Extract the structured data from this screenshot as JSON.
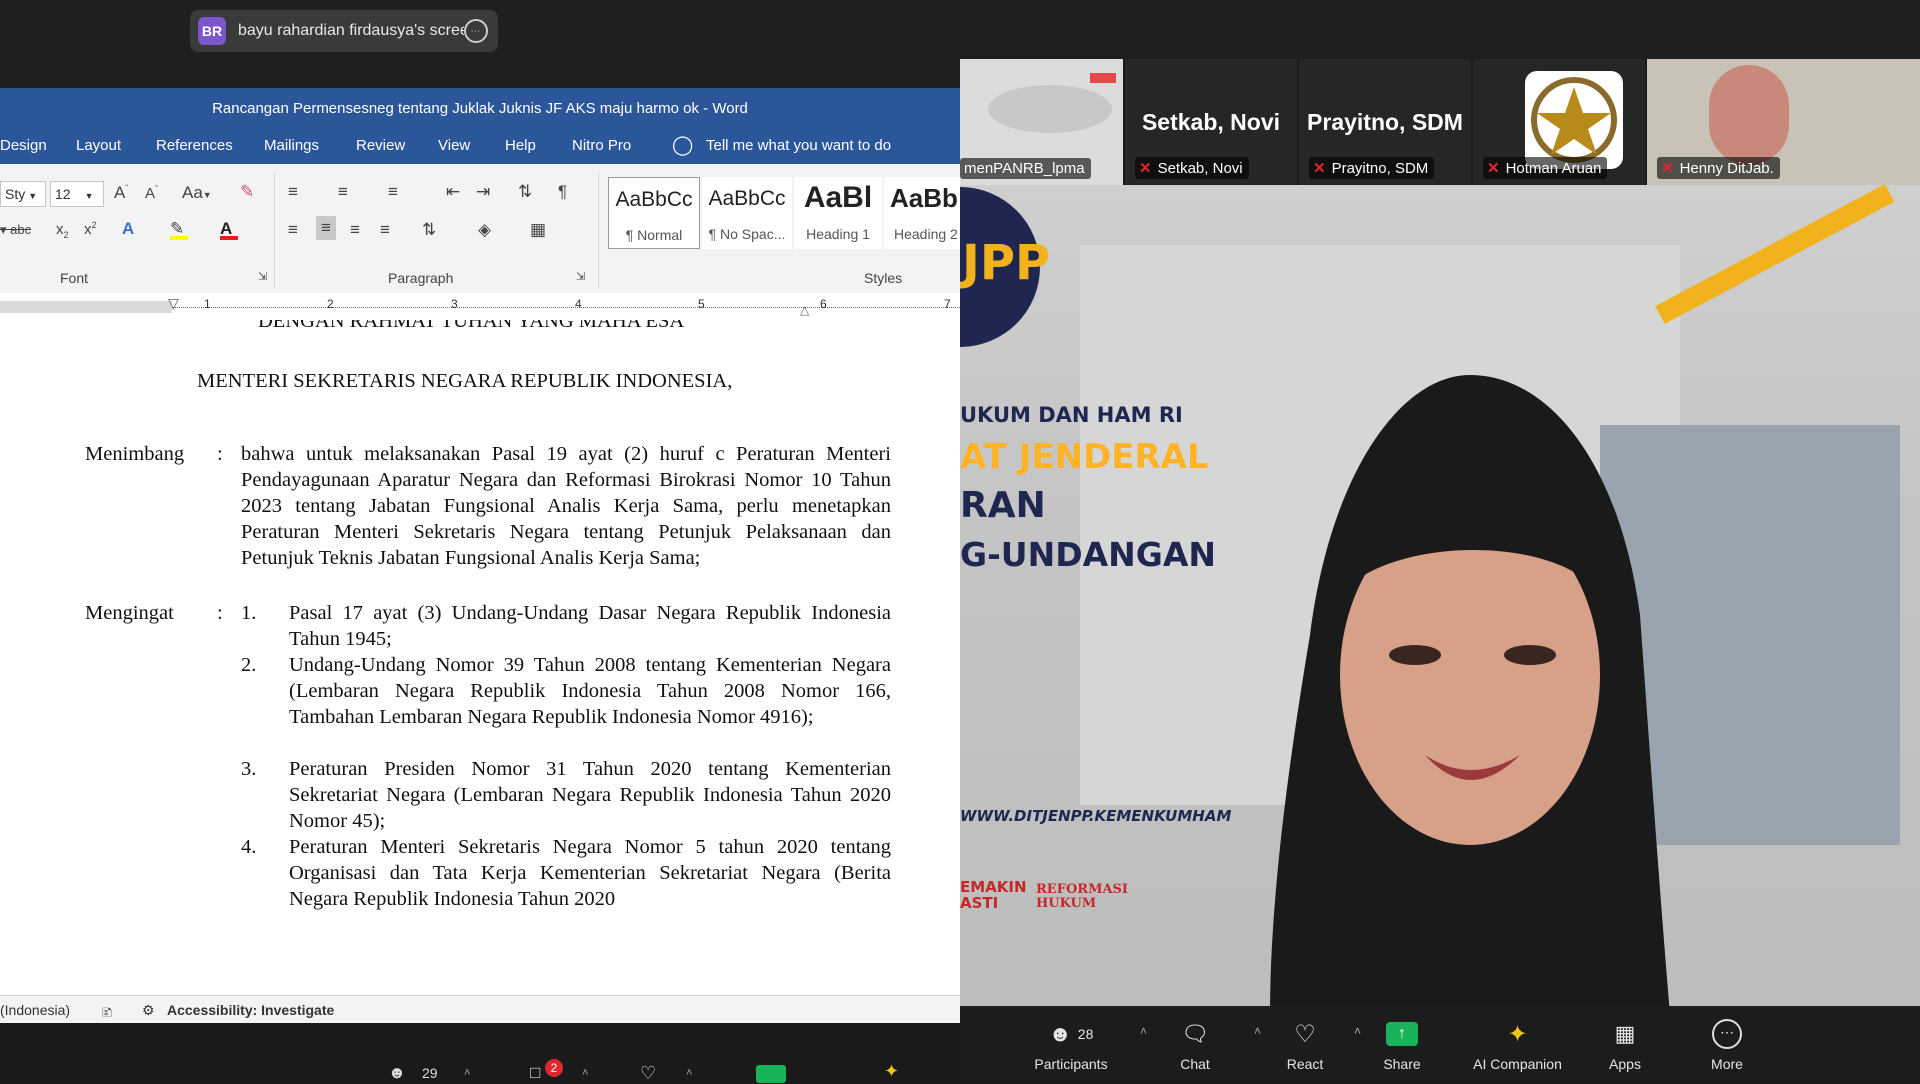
{
  "share_banner": {
    "avatar": "BR",
    "label": "bayu rahardian firdausya's screen",
    "more": "⋯"
  },
  "word": {
    "title": "Rancangan Permensesneg tentang Juklak Juknis JF AKS maju harmo ok  -  Word",
    "tabs": [
      "Design",
      "Layout",
      "References",
      "Mailings",
      "Review",
      "View",
      "Help",
      "Nitro Pro"
    ],
    "tell_me": "Tell me what you want to do",
    "ribbon": {
      "font_name": "Sty",
      "font_size": "12",
      "font_group": "Font",
      "paragraph_group": "Paragraph",
      "styles_group": "Styles",
      "styles": [
        {
          "preview": "AaBbCc",
          "name": "¶ Normal"
        },
        {
          "preview": "AaBbCc",
          "name": "¶ No Spac..."
        },
        {
          "preview": "AaBl",
          "name": "Heading 1"
        },
        {
          "preview": "AaBb",
          "name": "Heading 2"
        }
      ]
    },
    "ruler_numbers": [
      "1",
      "2",
      "3",
      "4",
      "5",
      "6",
      "7"
    ],
    "doc": {
      "top_cut": "DENGAN RAHMAT TUHAN YANG MAHA ESA",
      "heading": "MENTERI SEKRETARIS NEGARA REPUBLIK INDONESIA,",
      "menimbang_label": "Menimbang",
      "colon": ":",
      "menimbang_text": "bahwa untuk melaksanakan Pasal 19 ayat (2) huruf c Peraturan Menteri Pendayagunaan Aparatur Negara dan Reformasi Birokrasi Nomor 10 Tahun 2023 tentang Jabatan Fungsional Analis Kerja Sama, perlu menetapkan Peraturan Menteri Sekretaris Negara tentang Petunjuk Pelaksanaan dan Petunjuk Teknis Jabatan Fungsional Analis Kerja Sama;",
      "mengingat_label": "Mengingat",
      "mengingat_items": [
        {
          "num": "1.",
          "text": "Pasal 17 ayat (3) Undang-Undang Dasar Negara Republik Indonesia Tahun 1945;"
        },
        {
          "num": "2.",
          "text": "Undang-Undang Nomor 39 Tahun 2008 tentang Kementerian Negara (Lembaran Negara Republik Indonesia Tahun 2008 Nomor 166, Tambahan Lembaran Negara Republik Indonesia Nomor 4916);"
        },
        {
          "num": "3.",
          "text": "Peraturan Presiden Nomor 31 Tahun 2020 tentang Kementerian Sekretariat Negara (Lembaran Negara Republik Indonesia Tahun 2020 Nomor 45);"
        },
        {
          "num": "4.",
          "text": "Peraturan Menteri Sekretaris Negara Nomor 5 tahun 2020 tentang Organisasi dan Tata Kerja Kementerian Sekretariat Negara (Berita Negara Republik Indonesia Tahun 2020"
        }
      ]
    },
    "status": {
      "language": "(Indonesia)",
      "accessibility": "Accessibility: Investigate"
    }
  },
  "presenter_toolbar": {
    "participants_count": "29",
    "chat_badge": "2"
  },
  "thumbnails": [
    {
      "name": "menPANRB_lpma",
      "tag": "menPANRB_lpma",
      "muted": false
    },
    {
      "name": "Setkab, Novi",
      "tag": "Setkab, Novi",
      "muted": true
    },
    {
      "name": "Prayitno, SDM",
      "tag": "Prayitno, SDM",
      "muted": true
    },
    {
      "name": "",
      "tag": "Hotman Aruan",
      "muted": true
    },
    {
      "name": "",
      "tag": "Henny DitJab.",
      "muted": true
    }
  ],
  "video_banner": {
    "logo": "JPP",
    "line1": "UKUM DAN HAM RI",
    "line2": "AT JENDERAL",
    "line3": "RAN",
    "line4": "G-UNDANGAN",
    "url": "WWW.DITJENPP.KEMENKUMHAM",
    "footer1": "EMAKIN",
    "footer1b": "ASTI",
    "footer2": "REFORMASI",
    "footer2b": "HUKUM"
  },
  "zoom_toolbar": {
    "participants_count": "28",
    "buttons": [
      "Participants",
      "Chat",
      "React",
      "Share",
      "AI Companion",
      "Apps",
      "More"
    ]
  },
  "colors": {
    "word_blue": "#2b579a",
    "share_green": "#19b45a",
    "mute_red": "#e0262f",
    "banner_yellow": "#ffb428"
  }
}
